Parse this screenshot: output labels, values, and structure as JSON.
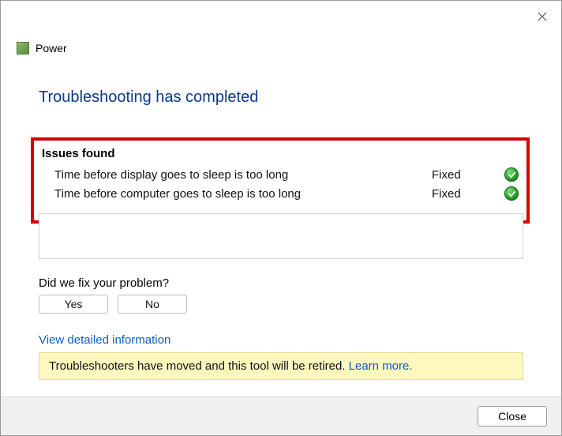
{
  "header": {
    "title": "Power"
  },
  "main": {
    "title": "Troubleshooting has completed"
  },
  "issues": {
    "heading": "Issues found",
    "items": [
      {
        "desc": "Time before display goes to sleep is too long",
        "status": "Fixed"
      },
      {
        "desc": "Time before computer goes to sleep is too long",
        "status": "Fixed"
      }
    ]
  },
  "feedback": {
    "question": "Did we fix your problem?",
    "yes": "Yes",
    "no": "No"
  },
  "links": {
    "view_detailed": "View detailed information",
    "learn_more": "Learn more."
  },
  "notice": {
    "text": "Troubleshooters have moved and this tool will be retired. "
  },
  "footer": {
    "close": "Close"
  }
}
